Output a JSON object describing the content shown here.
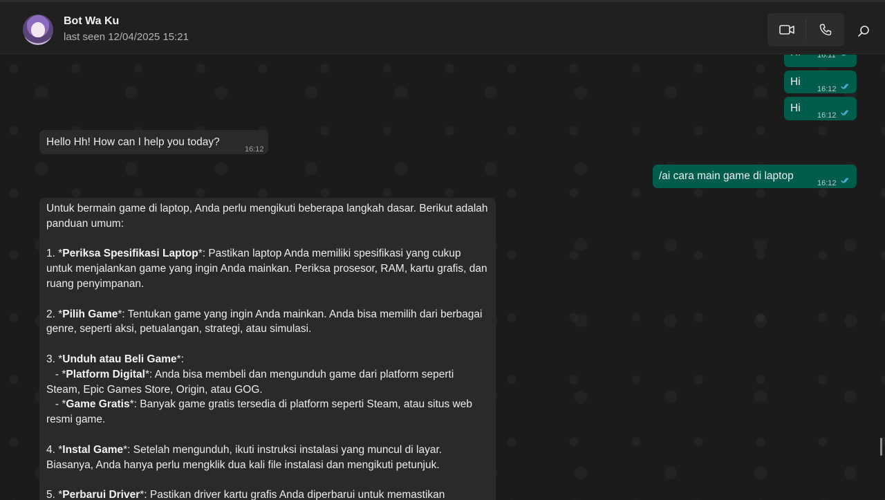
{
  "header": {
    "name": "Bot Wa Ku",
    "last_seen": "last seen 12/04/2025 15:21"
  },
  "icons": {
    "video": "video-camera-icon",
    "call": "phone-icon",
    "search": "search-icon"
  },
  "colors": {
    "outgoing_bubble": "#005c4b",
    "incoming_bubble": "#2a2a2a",
    "read_tick": "#53bdeb"
  },
  "messages": {
    "out_partial": {
      "text": "Hi",
      "time": "16:11"
    },
    "out_hi_1": {
      "text": "Hi",
      "time": "16:12"
    },
    "out_hi_2": {
      "text": "Hi",
      "time": "16:12"
    },
    "in_hello": {
      "text": "Hello Hh! How can I help you today?",
      "time": "16:12"
    },
    "out_ai": {
      "text": "/ai cara main game di laptop",
      "time": "16:12"
    }
  },
  "long_message": {
    "intro": "Untuk bermain game di laptop, Anda perlu mengikuti beberapa langkah dasar. Berikut adalah panduan umum:",
    "s1_num": "1. *",
    "s1_title": "Periksa Spesifikasi Laptop",
    "s1_body": "*: Pastikan laptop Anda memiliki spesifikasi yang cukup untuk menjalankan game yang ingin Anda mainkan. Periksa prosesor, RAM, kartu grafis, dan ruang penyimpanan.",
    "s2_num": "2. *",
    "s2_title": "Pilih Game",
    "s2_body": "*: Tentukan game yang ingin Anda mainkan. Anda bisa memilih dari berbagai genre, seperti aksi, petualangan, strategi, atau simulasi.",
    "s3_num": "3. *",
    "s3_title": "Unduh atau Beli Game",
    "s3_body": "*:",
    "s3a_num": "   - *",
    "s3a_title": "Platform Digital",
    "s3a_body": "*: Anda bisa membeli dan mengunduh game dari platform seperti Steam, Epic Games Store, Origin, atau GOG.",
    "s3b_num": "   - *",
    "s3b_title": "Game Gratis",
    "s3b_body": "*: Banyak game gratis tersedia di platform seperti Steam, atau situs web resmi game.",
    "s4_num": "4. *",
    "s4_title": "Instal Game",
    "s4_body": "*: Setelah mengunduh, ikuti instruksi instalasi yang muncul di layar. Biasanya, Anda hanya perlu mengklik dua kali file instalasi dan mengikuti petunjuk.",
    "s5_num": "5. *",
    "s5_title": "Perbarui Driver",
    "s5_body": "*: Pastikan driver kartu grafis Anda diperbarui untuk memastikan"
  }
}
